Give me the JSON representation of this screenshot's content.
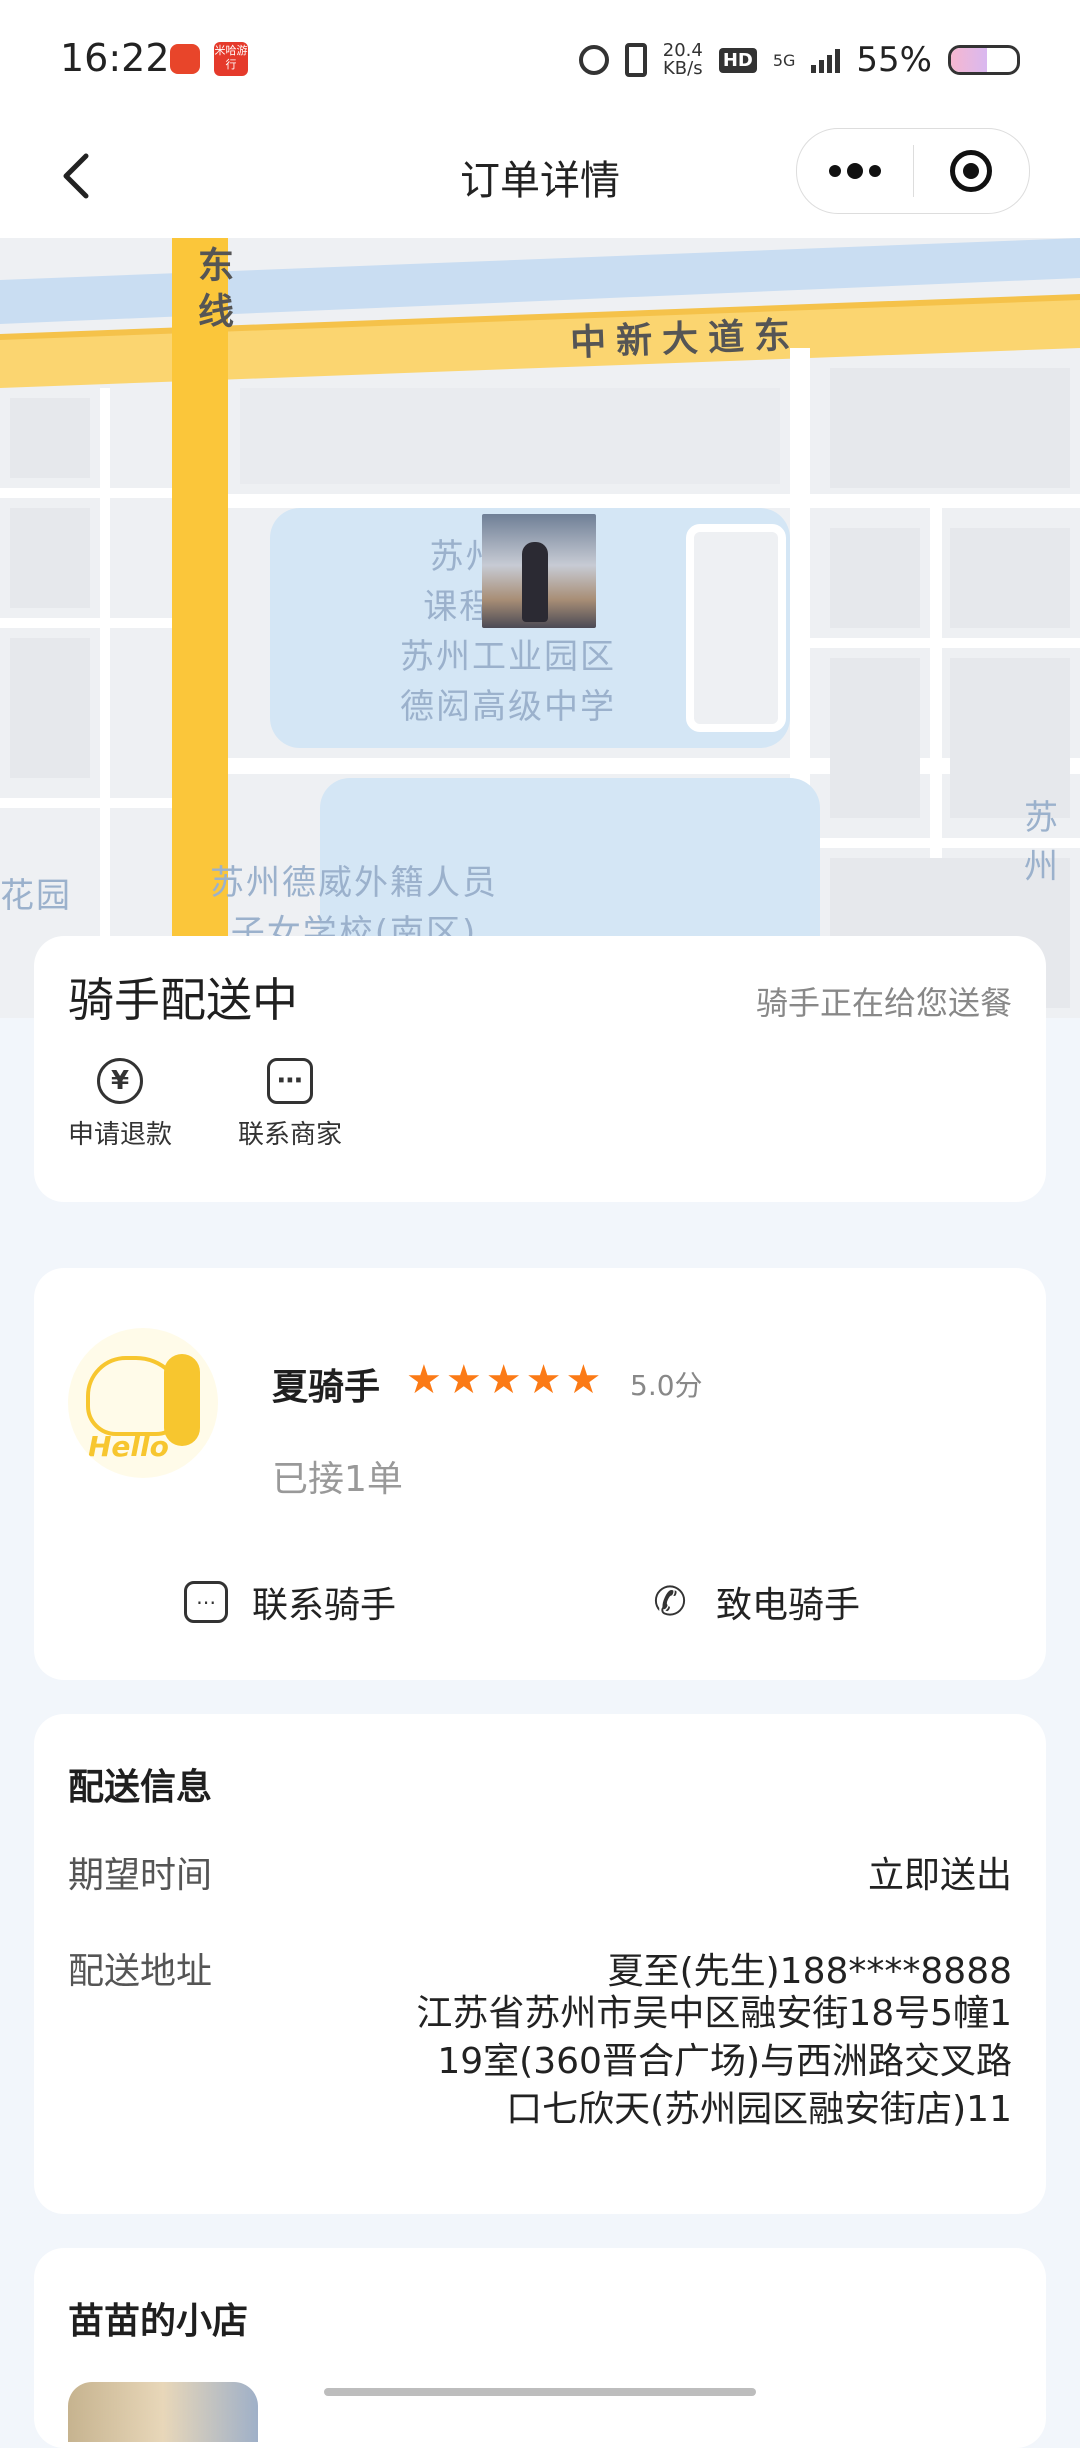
{
  "status_bar": {
    "time": "16:22",
    "app_badge": "米哈游行",
    "network_speed_value": "20.4",
    "network_speed_unit": "KB/s",
    "hd": "HD",
    "net_type": "5G",
    "battery": "55%",
    "battery_level": 0.55
  },
  "nav": {
    "title": "订单详情"
  },
  "map": {
    "road_east_line": "东线",
    "road_zhongxin": "中新大道东",
    "poi_school1_lines": [
      "苏州   国际",
      "课程   项目·",
      "苏州工业园区",
      "德闳高级中学"
    ],
    "poi_school2_lines": [
      "苏州德威外籍人员",
      "子女学校(南区)"
    ],
    "poi_garden": "花园",
    "poi_right": "苏州"
  },
  "status": {
    "title": "骑手配送中",
    "subtitle": "骑手正在给您送餐",
    "refund_label": "申请退款",
    "refund_icon": "¥",
    "contact_merchant_label": "联系商家"
  },
  "rider": {
    "name": "夏骑手",
    "rating": 5.0,
    "score_text": "5.0分",
    "orders_text": "已接1单",
    "avatar_text": "Hello",
    "contact_label": "联系骑手",
    "call_label": "致电骑手"
  },
  "delivery": {
    "title": "配送信息",
    "expect_label": "期望时间",
    "expect_value": "立即送出",
    "address_label": "配送地址",
    "recipient": "夏至(先生)188****8888",
    "address": "江苏省苏州市吴中区融安街18号5幢119室(360晋合广场)与西洲路交叉路口七欣天(苏州园区融安街店)11"
  },
  "shop": {
    "title": "苗苗的小店"
  },
  "colors": {
    "accent_orange": "#FB7A16",
    "road_yellow": "#FBD05A",
    "water_blue": "#D4E6F5",
    "page_bg": "#F2F6FB"
  }
}
